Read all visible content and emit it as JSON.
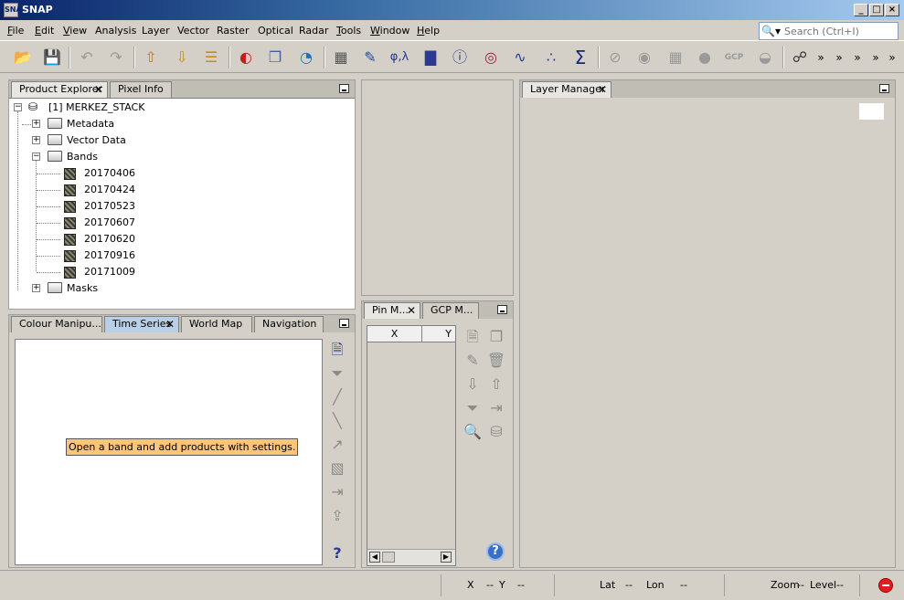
{
  "window": {
    "title": "SNAP",
    "logo": "SNAP",
    "min": "_",
    "max": "□",
    "close": "×"
  },
  "menu": [
    {
      "label": "File",
      "key": "F",
      "rest": "ile"
    },
    {
      "label": "Edit",
      "key": "E",
      "rest": "dit"
    },
    {
      "label": "View",
      "key": "V",
      "rest": "iew"
    },
    {
      "label": "Analysis",
      "key": "",
      "rest": "Analysis"
    },
    {
      "label": "Layer",
      "key": "",
      "rest": "Layer"
    },
    {
      "label": "Vector",
      "key": "",
      "rest": "Vector"
    },
    {
      "label": "Raster",
      "key": "",
      "rest": "Raster"
    },
    {
      "label": "Optical",
      "key": "",
      "rest": "Optical"
    },
    {
      "label": "Radar",
      "key": "",
      "rest": "Radar"
    },
    {
      "label": "Tools",
      "key": "T",
      "rest": "ools"
    },
    {
      "label": "Window",
      "key": "W",
      "rest": "indow"
    },
    {
      "label": "Help",
      "key": "H",
      "rest": "elp"
    }
  ],
  "search": {
    "placeholder": "Search (Ctrl+I)",
    "icon": "magnifier-icon"
  },
  "toolbar": {
    "phi_lambda": "φ,λ",
    "sum": "Σ",
    "gcp": "GCP",
    "more": "»"
  },
  "product_explorer": {
    "tabs": [
      {
        "label": "Product Explorer",
        "close": "✕"
      },
      {
        "label": "Pixel Info"
      }
    ],
    "root": "[1] MERKEZ_STACK",
    "nodes": {
      "metadata": "Metadata",
      "vector_data": "Vector Data",
      "bands": "Bands",
      "masks": "Masks"
    },
    "bands": [
      "20170406",
      "20170424",
      "20170523",
      "20170607",
      "20170620",
      "20170916",
      "20171009"
    ],
    "expand_plus": "+",
    "expand_minus": "−"
  },
  "bottom_tabs": [
    {
      "label": "Colour Manipu..."
    },
    {
      "label": "Time Series",
      "close": "✕"
    },
    {
      "label": "World Map"
    },
    {
      "label": "Navigation"
    }
  ],
  "time_series": {
    "hint": "Open a band and add products with settings.",
    "help": "?"
  },
  "pin_panel": {
    "tabs": [
      {
        "label": "Pin M...",
        "close": "✕"
      },
      {
        "label": "GCP M..."
      }
    ],
    "columns": [
      "X",
      "Y"
    ],
    "help": "?"
  },
  "layer_manager": {
    "tab": "Layer Manager",
    "close": "✕"
  },
  "status": {
    "x_label": "X",
    "x_val": "--",
    "y_label": "Y",
    "y_val": "--",
    "lat_label": "Lat",
    "lat_val": "--",
    "lon_label": "Lon",
    "lon_val": "--",
    "zoom_label": "Zoom",
    "zoom_val": "--",
    "level_label": "Level",
    "level_val": "--"
  }
}
